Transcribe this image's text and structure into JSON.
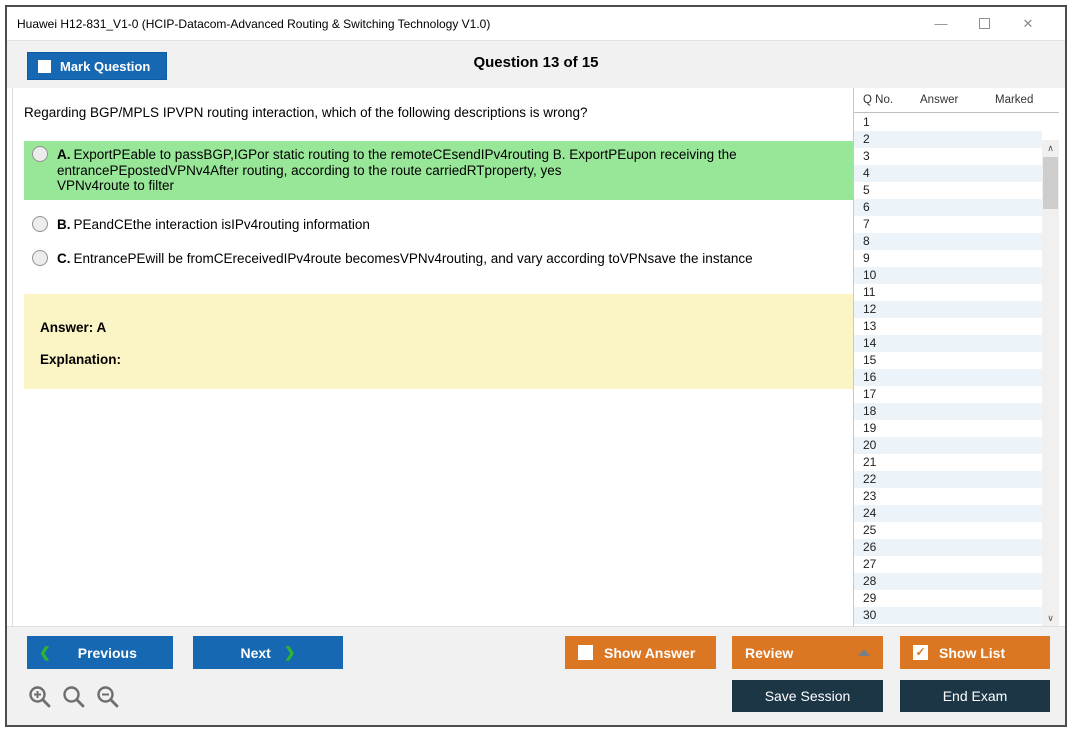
{
  "window": {
    "title": "Huawei H12-831_V1-0 (HCIP-Datacom-Advanced Routing & Switching Technology V1.0)"
  },
  "icons": {
    "minimize": "—",
    "close": "✕",
    "prev_chevron": "❮",
    "next_chevron": "❯",
    "check": "✓",
    "scroll_up": "∧",
    "scroll_down": "∨"
  },
  "colors": {
    "accent_blue": "#1668b2",
    "accent_orange": "#db7623",
    "dark_navy": "#1c3645",
    "highlight_green": "#98e698",
    "answer_yellow": "#fbf5c6",
    "row_alt_blue": "#ecf3f9"
  },
  "header": {
    "mark_question_label": "Mark Question",
    "question_counter": "Question 13 of 15"
  },
  "question": {
    "text": "Regarding BGP/MPLS IPVPN routing interaction, which of the following descriptions is wrong?",
    "options": [
      {
        "letter": "A.",
        "text": "ExportPEable to passBGP,IGPor static routing to the remoteCEsendIPv4routing B. ExportPEupon receiving the\nentrancePEpostedVPNv4After routing, according to the route carriedRTproperty, yes\nVPNv4route to filter",
        "highlighted": true
      },
      {
        "letter": "B.",
        "text": "PEandCEthe interaction isIPv4routing information",
        "highlighted": false
      },
      {
        "letter": "C.",
        "text": "EntrancePEwill be fromCEreceivedIPv4route becomesVPNv4routing, and vary according toVPNsave the instance",
        "highlighted": false
      }
    ]
  },
  "answer_panel": {
    "answer_label": "Answer: A",
    "explanation_label": "Explanation:"
  },
  "question_list": {
    "columns": [
      "Q No.",
      "Answer",
      "Marked"
    ],
    "rows": [
      {
        "no": "1",
        "answer": "",
        "marked": ""
      },
      {
        "no": "2",
        "answer": "",
        "marked": ""
      },
      {
        "no": "3",
        "answer": "",
        "marked": ""
      },
      {
        "no": "4",
        "answer": "",
        "marked": ""
      },
      {
        "no": "5",
        "answer": "",
        "marked": ""
      },
      {
        "no": "6",
        "answer": "",
        "marked": ""
      },
      {
        "no": "7",
        "answer": "",
        "marked": ""
      },
      {
        "no": "8",
        "answer": "",
        "marked": ""
      },
      {
        "no": "9",
        "answer": "",
        "marked": ""
      },
      {
        "no": "10",
        "answer": "",
        "marked": ""
      },
      {
        "no": "11",
        "answer": "",
        "marked": ""
      },
      {
        "no": "12",
        "answer": "",
        "marked": ""
      },
      {
        "no": "13",
        "answer": "",
        "marked": ""
      },
      {
        "no": "14",
        "answer": "",
        "marked": ""
      },
      {
        "no": "15",
        "answer": "",
        "marked": ""
      },
      {
        "no": "16",
        "answer": "",
        "marked": ""
      },
      {
        "no": "17",
        "answer": "",
        "marked": ""
      },
      {
        "no": "18",
        "answer": "",
        "marked": ""
      },
      {
        "no": "19",
        "answer": "",
        "marked": ""
      },
      {
        "no": "20",
        "answer": "",
        "marked": ""
      },
      {
        "no": "21",
        "answer": "",
        "marked": ""
      },
      {
        "no": "22",
        "answer": "",
        "marked": ""
      },
      {
        "no": "23",
        "answer": "",
        "marked": ""
      },
      {
        "no": "24",
        "answer": "",
        "marked": ""
      },
      {
        "no": "25",
        "answer": "",
        "marked": ""
      },
      {
        "no": "26",
        "answer": "",
        "marked": ""
      },
      {
        "no": "27",
        "answer": "",
        "marked": ""
      },
      {
        "no": "28",
        "answer": "",
        "marked": ""
      },
      {
        "no": "29",
        "answer": "",
        "marked": ""
      },
      {
        "no": "30",
        "answer": "",
        "marked": ""
      }
    ]
  },
  "footer": {
    "previous_label": "Previous",
    "next_label": "Next",
    "show_answer_label": "Show Answer",
    "review_label": "Review",
    "show_list_label": "Show List",
    "save_session_label": "Save Session",
    "end_exam_label": "End Exam"
  }
}
